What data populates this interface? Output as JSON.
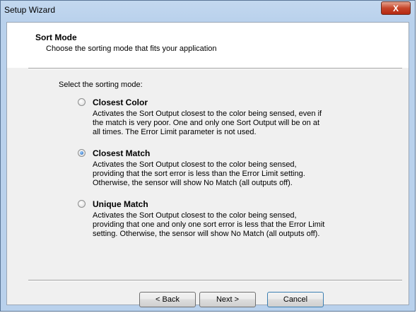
{
  "window": {
    "title": "Setup Wizard",
    "close_glyph": "X"
  },
  "header": {
    "title": "Sort Mode",
    "subtitle": "Choose the sorting mode that fits your application"
  },
  "prompt": "Select the sorting mode:",
  "selected_option": "Closest Match",
  "options": [
    {
      "label": "Closest Color",
      "selected": false,
      "description_lines": [
        "Activates the Sort Output closest to the color being sensed, even if",
        "the match is very poor. One and only one Sort Output will be on at",
        "all times. The Error Limit parameter is not used."
      ]
    },
    {
      "label": "Closest Match",
      "selected": true,
      "description_lines": [
        "Activates the Sort Output closest to the color being sensed,",
        "providing that the sort error is less than the Error Limit setting.",
        "Otherwise, the sensor will show No Match (all outputs off)."
      ]
    },
    {
      "label": "Unique Match",
      "selected": false,
      "description_lines": [
        "Activates the Sort Output closest to the color being sensed,",
        "providing that one and only one sort error is less that the Error Limit",
        "setting. Otherwise, the sensor will show No Match (all outputs off)."
      ]
    }
  ],
  "buttons": {
    "back": "< Back",
    "next": "Next >",
    "cancel": "Cancel"
  }
}
